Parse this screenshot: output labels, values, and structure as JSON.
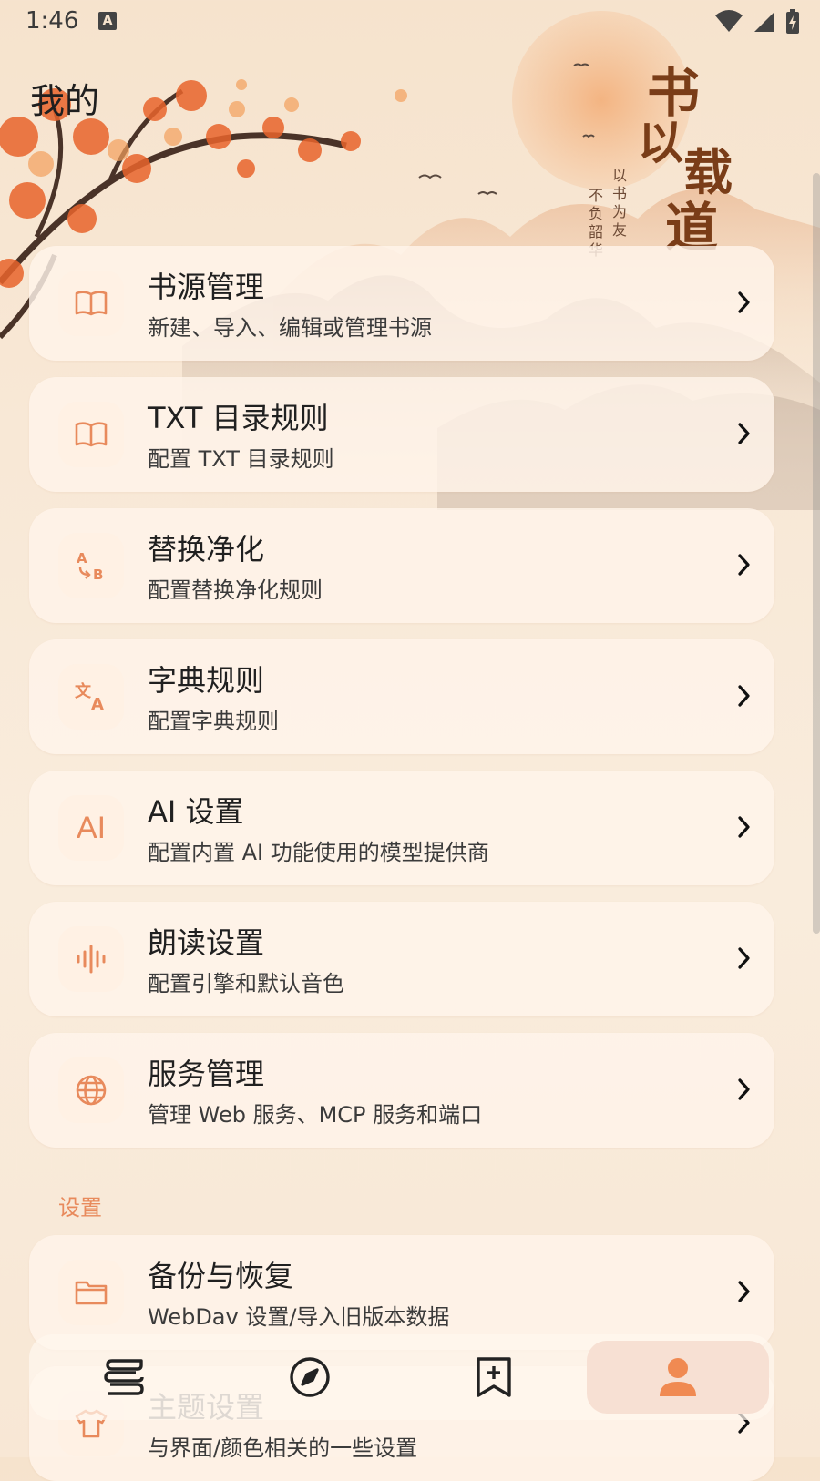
{
  "status_bar": {
    "time": "1:46",
    "notification_icon": "keyboard-a-icon",
    "icons": [
      "wifi-icon",
      "cell-signal-icon",
      "battery-charging-icon"
    ]
  },
  "page": {
    "title": "我的"
  },
  "banner": {
    "calligraphy_main": "书以载道",
    "calligraphy_side": "以书为友 不负韶华"
  },
  "colors": {
    "accent": "#e88a5c",
    "card_bg": "#fff4ea",
    "active_nav_bg": "#f7e0d3"
  },
  "items": [
    {
      "title": "书源管理",
      "subtitle": "新建、导入、编辑或管理书源",
      "icon": "book-open-icon"
    },
    {
      "title": "TXT 目录规则",
      "subtitle": "配置 TXT 目录规则",
      "icon": "book-open-icon"
    },
    {
      "title": "替换净化",
      "subtitle": "配置替换净化规则",
      "icon": "replace-ab-icon"
    },
    {
      "title": "字典规则",
      "subtitle": "配置字典规则",
      "icon": "translate-icon"
    },
    {
      "title": "AI 设置",
      "subtitle": "配置内置 AI 功能使用的模型提供商",
      "icon": "ai-icon",
      "icon_text": "AI"
    },
    {
      "title": "朗读设置",
      "subtitle": "配置引擎和默认音色",
      "icon": "voice-wave-icon"
    },
    {
      "title": "服务管理",
      "subtitle": "管理 Web 服务、MCP 服务和端口",
      "icon": "globe-icon"
    }
  ],
  "settings_section": {
    "label": "设置",
    "items": [
      {
        "title": "备份与恢复",
        "subtitle": "WebDav 设置/导入旧版本数据",
        "icon": "folder-icon"
      },
      {
        "title": "主题设置",
        "subtitle": "与界面/颜色相关的一些设置",
        "icon": "shirt-icon"
      }
    ]
  },
  "bottom_nav": {
    "items": [
      {
        "name": "bookshelf",
        "icon": "bookshelf-icon",
        "active": false
      },
      {
        "name": "discover",
        "icon": "compass-icon",
        "active": false
      },
      {
        "name": "rss",
        "icon": "bookmark-add-icon",
        "active": false
      },
      {
        "name": "my",
        "icon": "person-icon",
        "active": true
      }
    ]
  },
  "chevron": "❯"
}
